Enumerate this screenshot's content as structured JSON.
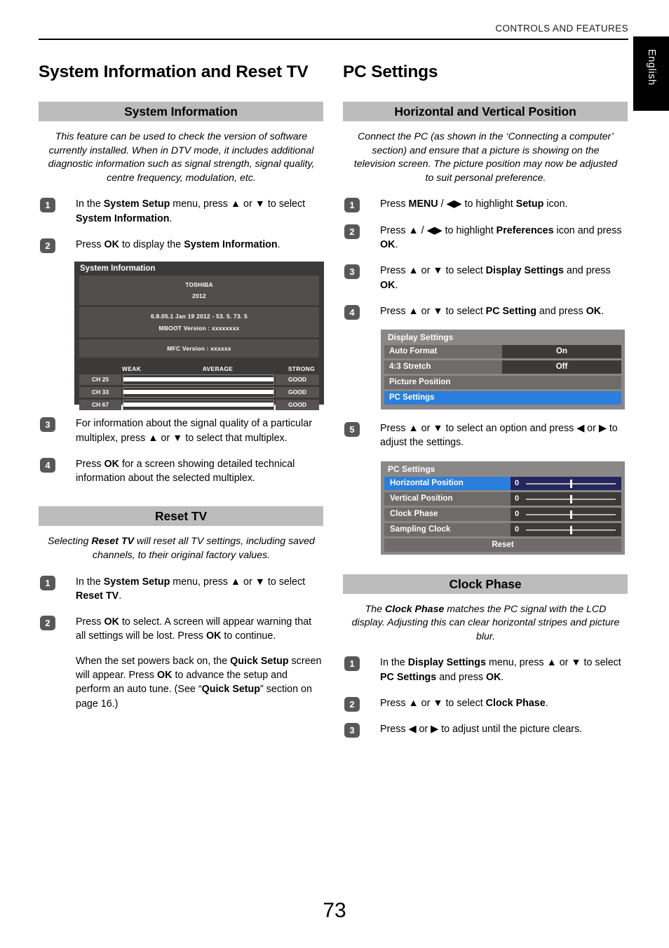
{
  "running_head": "CONTROLS AND FEATURES",
  "side_tab": "English",
  "page_number": "73",
  "left_column": {
    "chapter_title": "System Information and Reset TV",
    "section1": {
      "band": "System Information",
      "intro": "This feature can be used to check the version of software currently installed. When in DTV mode, it includes additional diagnostic information such as signal strength, signal quality, centre frequency, modulation, etc.",
      "steps": [
        {
          "num": "1",
          "text": "In the System Setup menu, press ▲ or ▼ to select System Information."
        },
        {
          "num": "2",
          "text": "Press OK to display the System Information."
        },
        {
          "num": "3",
          "text": "For information about the signal quality of a particular multiplex, press ▲ or ▼ to select that multiplex."
        },
        {
          "num": "4",
          "text": "Press OK for a screen showing detailed technical information about the selected multiplex."
        }
      ]
    },
    "sysinfo_screen": {
      "title": "System Information",
      "block1": [
        "TOSHIBA",
        "2012"
      ],
      "block2": [
        "6.8.05.1 Jan 19 2012 - 53. 5. 73. 5",
        "MBOOT Version : xxxxxxxx"
      ],
      "block3": [
        "MFC Version : xxxxxx"
      ],
      "scale": {
        "weak": "WEAK",
        "average": "AVERAGE",
        "strong": "STRONG"
      },
      "channels": [
        {
          "ch": "CH 25",
          "level": 100,
          "status": "GOOD"
        },
        {
          "ch": "CH 33",
          "level": 100,
          "status": "GOOD"
        },
        {
          "ch": "CH 67",
          "level": 100,
          "status": "GOOD"
        }
      ]
    },
    "section2": {
      "band": "Reset TV",
      "intro": "Selecting Reset TV will reset all TV settings, including saved channels, to their original factory values.",
      "steps": [
        {
          "num": "1",
          "text": "In the System Setup menu, press ▲ or ▼ to select Reset TV."
        },
        {
          "num": "2",
          "text": "Press OK to select. A screen will appear warning that all settings will be lost. Press OK to continue.",
          "text2": "When the set powers back on, the Quick Setup screen will appear. Press OK to advance the setup and perform an auto tune. (See “Quick Setup” section on page 16.)"
        }
      ]
    }
  },
  "right_column": {
    "chapter_title": "PC Settings",
    "section1": {
      "band": "Horizontal and Vertical Position",
      "intro": "Connect the PC (as shown in the ‘Connecting a computer’ section) and ensure that a picture is showing on the television screen. The picture position may now be adjusted to suit personal preference.",
      "steps": [
        {
          "num": "1",
          "text": "Press MENU / ◀▶ to highlight Setup icon."
        },
        {
          "num": "2",
          "text": "Press ▲ / ◀▶ to highlight Preferences icon and press OK."
        },
        {
          "num": "3",
          "text": "Press ▲ or ▼ to select Display Settings and press OK."
        },
        {
          "num": "4",
          "text": "Press ▲ or ▼ to select PC Setting and press OK."
        },
        {
          "num": "5",
          "text": "Press ▲ or ▼ to select an option and press ◀ or ▶ to adjust the settings."
        }
      ]
    },
    "display_settings_menu": {
      "title": "Display Settings",
      "items": [
        {
          "label": "Auto Format",
          "value": "On",
          "selected": false
        },
        {
          "label": "4:3 Stretch",
          "value": "Off",
          "selected": false
        },
        {
          "label": "Picture Position",
          "value": "",
          "selected": false
        },
        {
          "label": "PC Settings",
          "value": "",
          "selected": true
        }
      ]
    },
    "pc_settings_menu": {
      "title": "PC Settings",
      "items": [
        {
          "label": "Horizontal Position",
          "value": "0",
          "selected": true
        },
        {
          "label": "Vertical Position",
          "value": "0",
          "selected": false
        },
        {
          "label": "Clock Phase",
          "value": "0",
          "selected": false
        },
        {
          "label": "Sampling Clock",
          "value": "0",
          "selected": false
        }
      ],
      "reset": "Reset"
    },
    "section2": {
      "band": "Clock Phase",
      "intro": "The Clock Phase matches the PC signal with the LCD display. Adjusting this can clear horizontal stripes and picture blur.",
      "steps": [
        {
          "num": "1",
          "text": "In the Display Settings menu, press ▲ or ▼ to select PC Settings and press OK."
        },
        {
          "num": "2",
          "text": "Press ▲ or ▼ to select Clock Phase."
        },
        {
          "num": "3",
          "text": "Press ◀ or ▶ to adjust until the picture clears."
        }
      ]
    }
  }
}
